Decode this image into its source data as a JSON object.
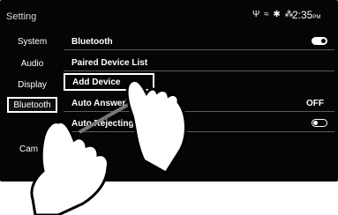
{
  "header": {
    "title": "Setting",
    "status_icons": "Ψ ≈ ✱ ⁂",
    "time": "2:35",
    "time_suffix": "PM"
  },
  "sidebar": {
    "items": [
      {
        "label": "System"
      },
      {
        "label": "Audio"
      },
      {
        "label": "Display"
      },
      {
        "label": "Bluetooth"
      },
      {
        "label": "Cam"
      }
    ]
  },
  "list": {
    "rows": [
      {
        "label": "Bluetooth",
        "toggle": "on"
      },
      {
        "label": "Paired Device List"
      },
      {
        "label": "Add Device"
      },
      {
        "label": "Auto Answer",
        "value": "OFF"
      },
      {
        "label": "Auto Rejecting",
        "toggle": "off"
      }
    ]
  }
}
